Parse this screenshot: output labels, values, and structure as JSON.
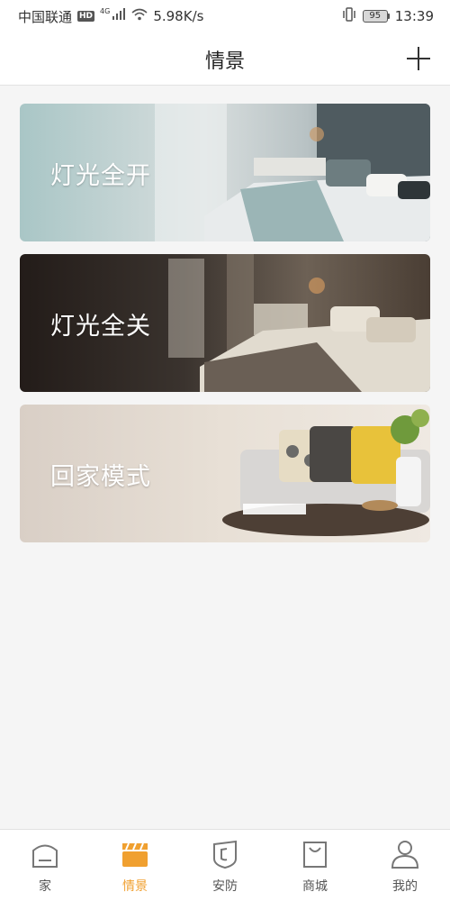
{
  "status_bar": {
    "carrier": "中国联通",
    "hd": "HD",
    "network": "4G",
    "speed": "5.98K/s",
    "battery": "95",
    "time": "13:39"
  },
  "header": {
    "title": "情景",
    "add_icon": "plus-icon"
  },
  "scenes": [
    {
      "label": "灯光全开",
      "theme": "bright-bedroom"
    },
    {
      "label": "灯光全关",
      "theme": "dark-bedroom"
    },
    {
      "label": "回家模式",
      "theme": "living-room"
    }
  ],
  "tabs": [
    {
      "label": "家",
      "icon": "home-icon",
      "active": false
    },
    {
      "label": "情景",
      "icon": "scene-icon",
      "active": true
    },
    {
      "label": "安防",
      "icon": "shield-icon",
      "active": false
    },
    {
      "label": "商城",
      "icon": "shopping-bag-icon",
      "active": false
    },
    {
      "label": "我的",
      "icon": "user-icon",
      "active": false
    }
  ],
  "colors": {
    "accent": "#f0a030",
    "inactive_icon": "#777777",
    "background": "#f5f5f5"
  }
}
